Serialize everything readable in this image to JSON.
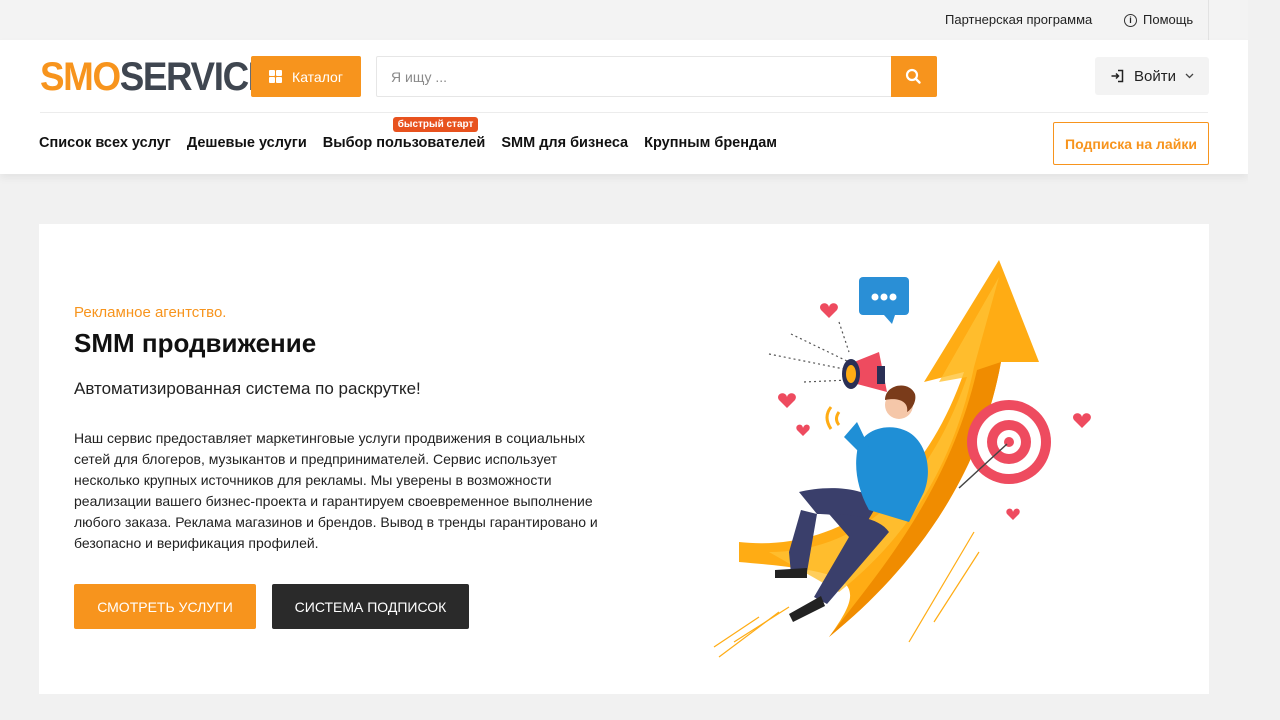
{
  "topbar": {
    "partner_label": "Партнерская программа",
    "help_label": "Помощь"
  },
  "header": {
    "logo_part1": "SMO",
    "logo_part2": "SERVICE",
    "catalog_label": "Каталог",
    "search_placeholder": "Я ищу ...",
    "login_label": "Войти",
    "subscribe_label": "Подписка на лайки"
  },
  "nav": {
    "items": [
      {
        "label": "Список всех услуг"
      },
      {
        "label": "Дешевые услуги"
      },
      {
        "label": "Выбор пользователей",
        "badge": "быстрый старт"
      },
      {
        "label": "SMM для бизнеса"
      },
      {
        "label": "Крупным брендам"
      }
    ]
  },
  "hero": {
    "eyebrow": "Рекламное агентство.",
    "title": "SMM продвижение",
    "subtitle": "Автоматизированная система по раскрутке!",
    "text": "Наш сервис предоставляет маркетинговые услуги продвижения в социальных сетей для блогеров, музыкантов и предпринимателей. Сервис использует несколько крупных источников для рекламы. Мы уверены в возможности реализации вашего бизнес-проекта и гарантируем своевременное выполнение любого заказа. Реклама магазинов и брендов. Вывод в тренды гарантировано и безопасно и верификация профилей.",
    "primary_button": "СМОТРЕТЬ УСЛУГИ",
    "secondary_button": "СИСТЕМА ПОДПИСОК"
  },
  "colors": {
    "accent": "#f7941d",
    "dark": "#2a2a2a",
    "badge": "#e8521e"
  },
  "icons": [
    "grid-icon",
    "search-icon",
    "login-icon",
    "chevron-down-icon",
    "info-icon",
    "megaphone-illustration"
  ]
}
